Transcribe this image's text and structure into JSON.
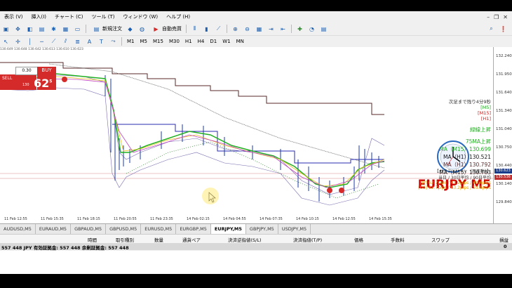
{
  "menu": {
    "items": [
      "表示 (V)",
      "挿入(I)",
      "チャート (C)",
      "ツール (T)",
      "ウィンドウ (W)",
      "ヘルプ (H)"
    ],
    "window_controls": [
      "–",
      "❐",
      "✕"
    ]
  },
  "toolbar": {
    "new_order_label": "新規注文",
    "auto_trade_label": "自動売買",
    "timeframes": [
      "M1",
      "M5",
      "M15",
      "M30",
      "H1",
      "H4",
      "D1",
      "W1",
      "MN"
    ]
  },
  "trade_panel": {
    "price_strip": "130.649 130.648 130.642 130.613 130.610 130.623",
    "sell_label": "SELL",
    "buy_label": "BUY",
    "lot": "0.30",
    "bid_prefix": "130",
    "bid_big": "62",
    "bid_sup": "5",
    "ask_big": "62",
    "ask_sup": "5"
  },
  "chart_info": {
    "next_bar": "次足まで残り4分9秒",
    "tf_m5": "[M5]",
    "tf_m15": "[M15]",
    "tf_h1": "[H1]",
    "trend_line": "緑線上昇",
    "ma75": "75MA上昇",
    "ma_m15": "MA（M15）130.699",
    "ma_h1_a": "MA（H1）130.521",
    "ma_h1_b": "MA（H1）130.792",
    "ma_m15_b": "MA（M15）130.783",
    "symbol_title": "EURJPY M5",
    "vol_title": "【ボラティリティ（両変動）】",
    "vol_header": "当日 / 30日平均 / 90日平均",
    "vol_jp": "[JP] 62.7pips / 43.2pips / 40.6pips",
    "vol_us": "[US] 62.7pips / 63.2pips / 59.6pips"
  },
  "price_axis": {
    "labels": [
      "132.240",
      "131.950",
      "131.640",
      "131.340",
      "131.040",
      "130.750",
      "130.440",
      "130.140",
      "129.840"
    ],
    "current_price_tag": "130.623",
    "other_tag": "130.536"
  },
  "time_axis": {
    "labels": [
      "11 Feb 12:55",
      "11 Feb 15:35",
      "11 Feb 18:15",
      "11 Feb 20:55",
      "11 Feb 23:35",
      "14 Feb 02:15",
      "14 Feb 04:55",
      "14 Feb 07:35",
      "14 Feb 10:15",
      "14 Feb 12:55",
      "14 Feb 15:35"
    ]
  },
  "symbol_tabs": [
    "AUDUSD,M5",
    "EURAUD,M5",
    "GBPAUD,M5",
    "GBPUSD,M5",
    "EURUSD,M5",
    "EURGBP,M5",
    "EURJPY,M5",
    "GBPJPY,M5",
    "USDJPY,M5"
  ],
  "active_tab": "EURJPY,M5",
  "terminal": {
    "columns": [
      "時間",
      "取引種別",
      "数量",
      "通貨ペア",
      "決済逆指値(S/L)",
      "決済指値(T/P)",
      "価格",
      "手数料",
      "スワップ",
      "損益"
    ],
    "balance_row": "557 448 JPY  有効証拠金: 557 448  余剰証拠金: 557 448",
    "balance_value": "0"
  },
  "colors": {
    "sell_red": "#d42a2a",
    "ma_green": "#22b022",
    "candle_blue": "#1a3aa8",
    "symbol_red": "#cc0000"
  }
}
